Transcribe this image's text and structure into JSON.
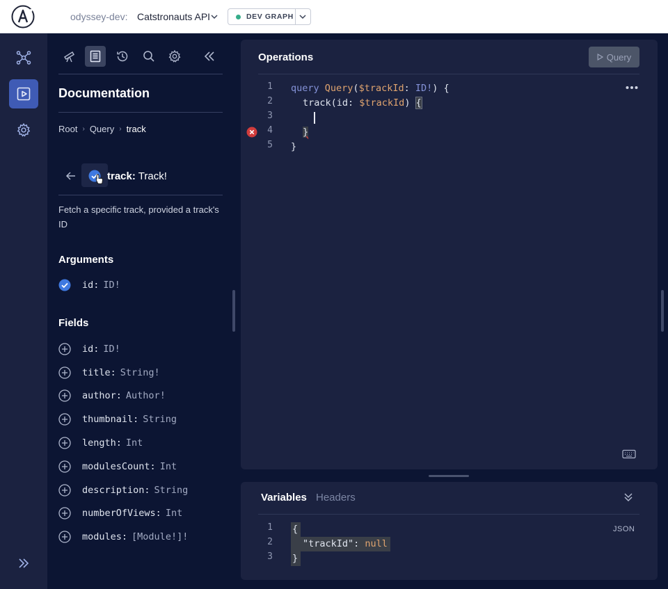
{
  "header": {
    "org": "odyssey-dev:",
    "graph_name": "Catstronauts API",
    "variant": "DEV GRAPH",
    "colors": {
      "variant_dot": "#36ad8a"
    }
  },
  "rail": {
    "items": [
      {
        "icon": "schema-graph-icon",
        "active": false
      },
      {
        "icon": "explorer-play-icon",
        "active": true
      },
      {
        "icon": "settings-gear-icon",
        "active": false
      }
    ],
    "expand_icon": "double-chevron-right-icon"
  },
  "docs": {
    "toolbar": [
      "telescope-icon",
      "document-icon",
      "history-icon",
      "search-icon",
      "gear-icon",
      "collapse-icon"
    ],
    "title": "Documentation",
    "breadcrumbs": [
      "Root",
      "Query",
      "track"
    ],
    "field": {
      "name": "track:",
      "type": "Track!"
    },
    "description": "Fetch a specific track, provided a track's ID",
    "arguments_title": "Arguments",
    "arguments": [
      {
        "name": "id",
        "type": "ID!",
        "selected": true
      }
    ],
    "fields_title": "Fields",
    "fields": [
      {
        "name": "id",
        "type": "ID!"
      },
      {
        "name": "title",
        "type": "String!"
      },
      {
        "name": "author",
        "type": "Author!"
      },
      {
        "name": "thumbnail",
        "type": "String"
      },
      {
        "name": "length",
        "type": "Int"
      },
      {
        "name": "modulesCount",
        "type": "Int"
      },
      {
        "name": "description",
        "type": "String"
      },
      {
        "name": "numberOfViews",
        "type": "Int"
      },
      {
        "name": "modules",
        "type": "[Module!]!"
      }
    ]
  },
  "operations": {
    "title": "Operations",
    "run_label": "Query",
    "line_numbers": [
      "1",
      "2",
      "3",
      "4",
      "5"
    ],
    "code": {
      "l1_kw": "query",
      "l1_name": "Query",
      "l1_open": "(",
      "l1_var": "$trackId",
      "l1_colon": ": ",
      "l1_type": "ID!",
      "l1_close": ") {",
      "l2_field": "track",
      "l2_open": "(id: ",
      "l2_var": "$trackId",
      "l2_close": ") ",
      "l2_brace": "{",
      "l4_brace": "}",
      "l5_brace": "}"
    },
    "error_line": "4"
  },
  "variables": {
    "tabs": [
      "Variables",
      "Headers"
    ],
    "format_label": "JSON",
    "line_numbers": [
      "1",
      "2",
      "3"
    ],
    "code": {
      "l1": "{",
      "l2_key": "\"trackId\"",
      "l2_colon": ": ",
      "l2_val": "null",
      "l3": "}"
    }
  }
}
